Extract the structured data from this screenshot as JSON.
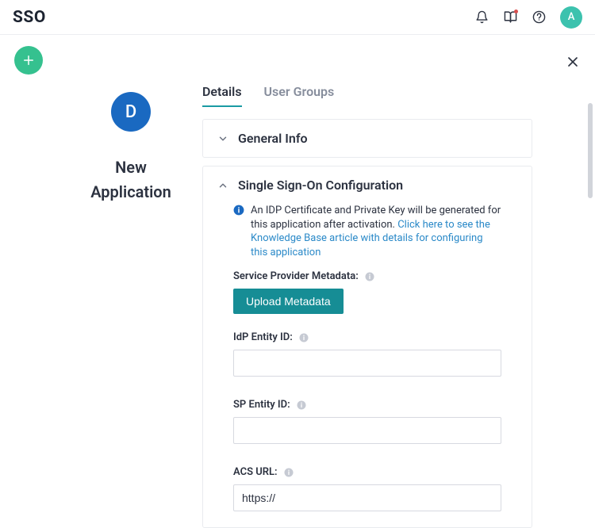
{
  "brand": "SSO",
  "avatar_letter": "A",
  "app": {
    "avatar_letter": "D",
    "title_line1": "New",
    "title_line2": "Application"
  },
  "tabs": {
    "details": "Details",
    "user_groups": "User Groups"
  },
  "sections": {
    "general_info": {
      "title": "General Info"
    },
    "sso": {
      "title": "Single Sign-On Configuration",
      "info_text": "An IDP Certificate and Private Key will be generated for this application after activation. ",
      "info_link": "Click here to see the Knowledge Base article with details for configuring this application",
      "sp_metadata_label": "Service Provider Metadata:",
      "upload_btn": "Upload Metadata",
      "idp_entity_label": "IdP Entity ID:",
      "idp_entity_value": "",
      "sp_entity_label": "SP Entity ID:",
      "sp_entity_value": "",
      "acs_url_label": "ACS URL:",
      "acs_url_value": "https://"
    }
  }
}
